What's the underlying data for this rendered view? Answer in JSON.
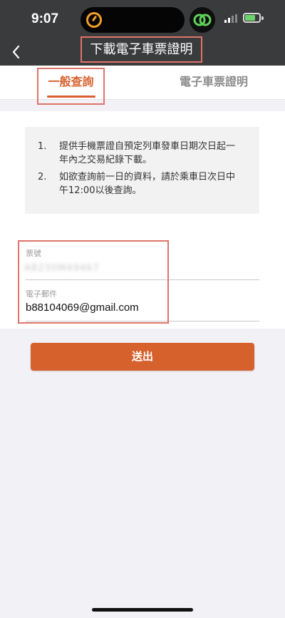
{
  "status_bar": {
    "time": "9:07",
    "icons": [
      "timer-icon",
      "linked-app-icon",
      "signal-icon",
      "battery-charging-icon"
    ]
  },
  "nav": {
    "title": "下載電子車票證明",
    "back_icon": "chevron-left-icon"
  },
  "tabs": [
    {
      "label": "一般查詢",
      "active": true
    },
    {
      "label": "電子車票證明",
      "active": false
    }
  ],
  "notice": [
    {
      "num": "1.",
      "text": "提供手機票證自預定列車發車日期次日起一年內之交易紀錄下載。"
    },
    {
      "num": "2.",
      "text": "如欲查詢前一日的資料，請於乘車日次日中午12:00以後查詢。"
    }
  ],
  "form": {
    "ticket_label": "票號",
    "ticket_value": "A8230M49467",
    "email_label": "電子郵件",
    "email_value": "b88104069@gmail.com",
    "submit_label": "送出"
  },
  "colors": {
    "accent": "#d6612d",
    "annotation": "#e0736a",
    "header_bg": "#3a3b3d"
  }
}
